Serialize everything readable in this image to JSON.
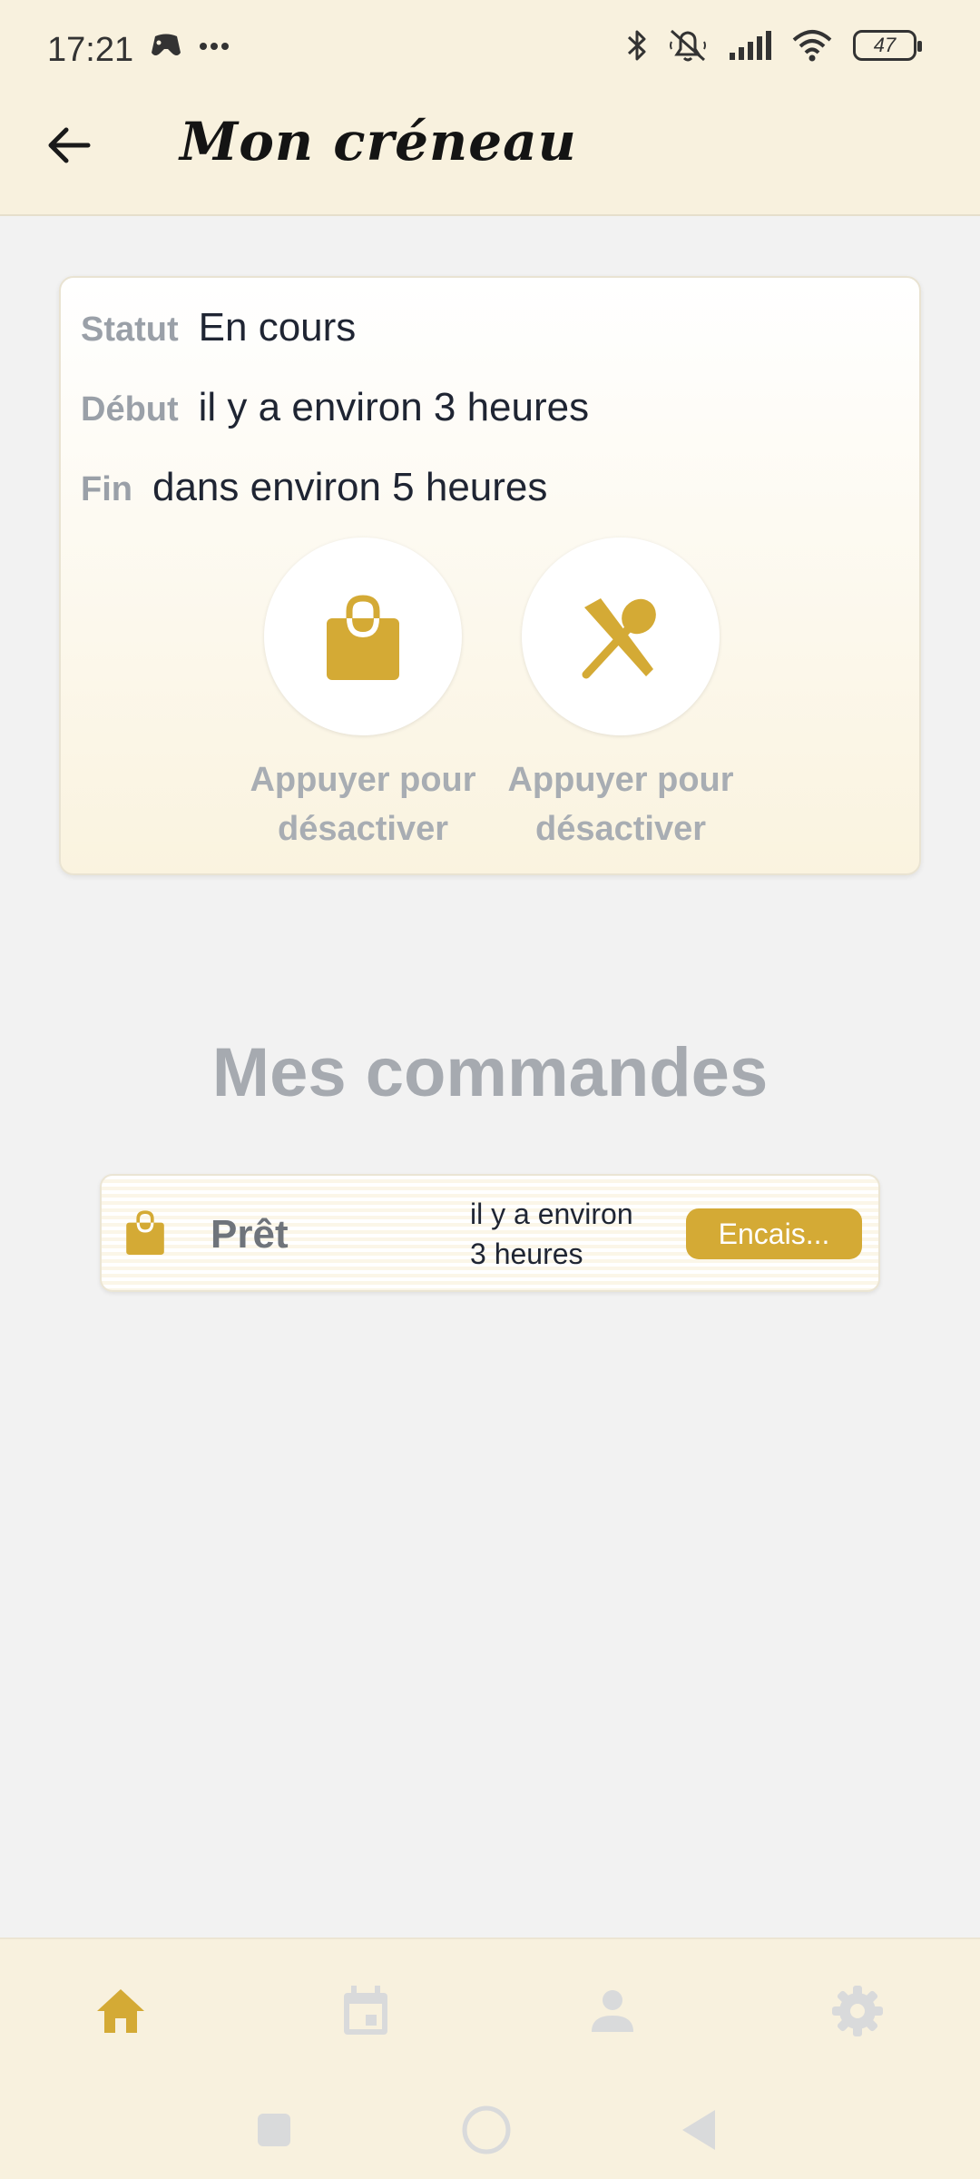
{
  "status_bar": {
    "time": "17:21",
    "battery": "47",
    "icons": [
      "game-controller-icon",
      "more-dots-icon",
      "bluetooth-icon",
      "silent-icon",
      "signal-icon",
      "wifi-icon",
      "battery-icon"
    ]
  },
  "app_bar": {
    "title": "Mon créneau",
    "back_icon": "arrow-back-icon"
  },
  "slot": {
    "status_label": "Statut",
    "status_value": "En cours",
    "start_label": "Début",
    "start_value": "il y a environ 3 heures",
    "end_label": "Fin",
    "end_value": "dans environ 5 heures",
    "toggles": [
      {
        "icon": "shopping-bag-icon",
        "caption": "Appuyer pour désactiver"
      },
      {
        "icon": "utensils-icon",
        "caption": "Appuyer pour désactiver"
      }
    ]
  },
  "orders": {
    "title": "Mes commandes",
    "items": [
      {
        "icon": "shopping-bag-icon",
        "status": "Prêt",
        "time": "il y a environ 3 heures",
        "action_label": "Encais..."
      }
    ]
  },
  "bottom_nav": {
    "items": [
      {
        "icon": "home-icon",
        "active": true
      },
      {
        "icon": "calendar-icon",
        "active": false
      },
      {
        "icon": "person-icon",
        "active": false
      },
      {
        "icon": "settings-icon",
        "active": false
      }
    ]
  },
  "colors": {
    "accent": "#d4aa35",
    "header_bg": "#f8f1de",
    "page_bg": "#f2f2f2",
    "muted_text": "#a6aab0"
  }
}
